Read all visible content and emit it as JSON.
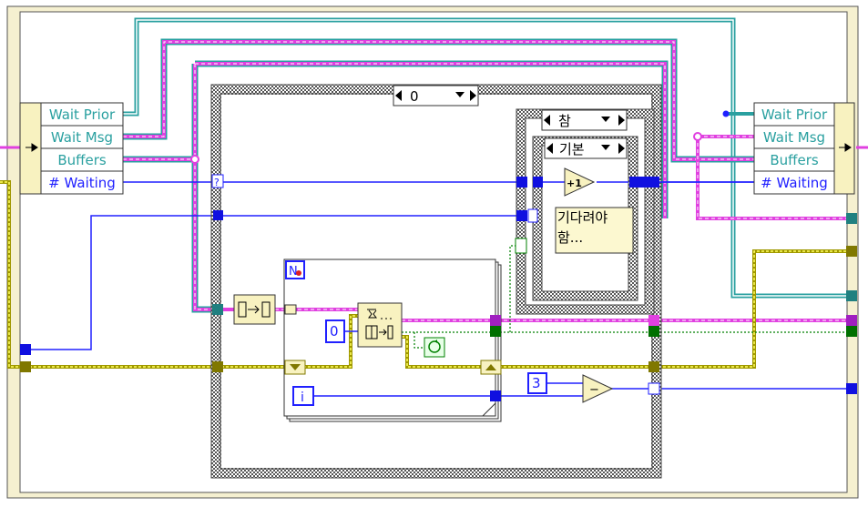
{
  "unbundle_left": {
    "items": [
      "Wait Prior",
      "Wait Msg",
      "Buffers",
      "# Waiting"
    ]
  },
  "bundle_right": {
    "items": [
      "Wait Prior",
      "Wait Msg",
      "Buffers",
      "# Waiting"
    ]
  },
  "outer_case": {
    "selector": "0"
  },
  "case_true": {
    "selector": "참"
  },
  "case_default": {
    "selector": "기본",
    "note": "기다려야 함...",
    "increment": "+1"
  },
  "for_loop": {
    "count_terminal": "N",
    "iteration_terminal": "i",
    "const_zero": "0"
  },
  "subtract": {
    "const_three": "3",
    "symbol": "−"
  },
  "colors": {
    "cluster_wire": "#2aa0a0",
    "array_wire": "#e040e0",
    "int_wire": "#2020ff",
    "error_wire": "#a09800",
    "bool_wire": "#008000"
  }
}
